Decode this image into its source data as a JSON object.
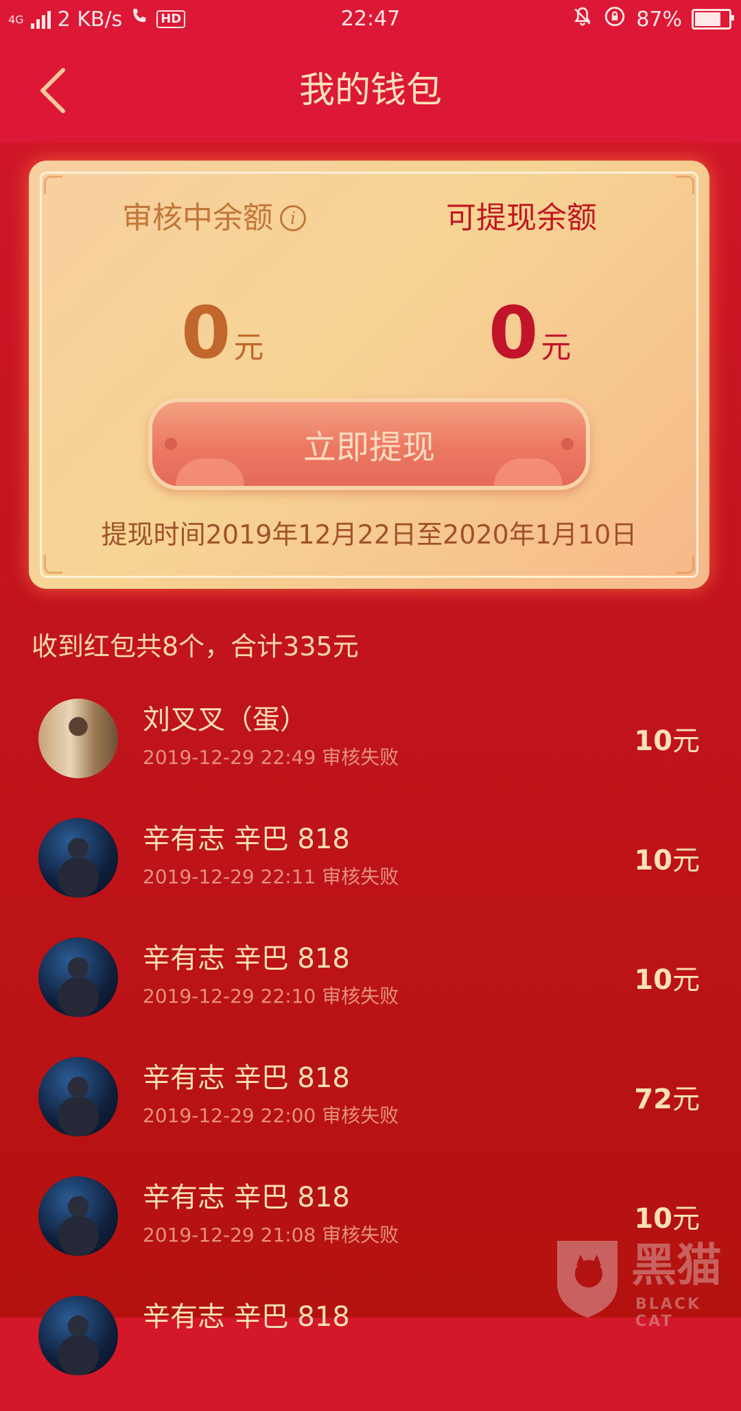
{
  "status_bar": {
    "network": "4G",
    "speed": "2 KB/s",
    "hd": "HD",
    "time": "22:47",
    "battery": "87%",
    "battery_level": 0.87
  },
  "header": {
    "title": "我的钱包"
  },
  "card": {
    "pending_label": "审核中余额",
    "withdrawable_label": "可提现余额",
    "pending_amount": "0",
    "withdrawable_amount": "0",
    "unit": "元",
    "button_label": "立即提现",
    "withdraw_time": "提现时间2019年12月22日至2020年1月10日"
  },
  "summary": "收到红包共8个，合计335元",
  "items": [
    {
      "name": "刘叉叉（蛋）",
      "meta": "2019-12-29 22:49 审核失败",
      "amount": "10",
      "unit": "元",
      "avatar": "room"
    },
    {
      "name": "辛有志 辛巴 818",
      "meta": "2019-12-29 22:11 审核失败",
      "amount": "10",
      "unit": "元",
      "avatar": "stage"
    },
    {
      "name": "辛有志 辛巴 818",
      "meta": "2019-12-29 22:10 审核失败",
      "amount": "10",
      "unit": "元",
      "avatar": "stage"
    },
    {
      "name": "辛有志 辛巴 818",
      "meta": "2019-12-29 22:00 审核失败",
      "amount": "72",
      "unit": "元",
      "avatar": "stage"
    },
    {
      "name": "辛有志 辛巴 818",
      "meta": "2019-12-29 21:08 审核失败",
      "amount": "10",
      "unit": "元",
      "avatar": "stage"
    },
    {
      "name": "辛有志 辛巴 818",
      "meta": "",
      "amount": "",
      "unit": "",
      "avatar": "stage"
    }
  ],
  "watermark": {
    "text": "黑猫",
    "sub": "BLACK CAT"
  },
  "colors": {
    "header": "#dc1836",
    "background": "#c41420",
    "card": "#f6d494",
    "accent_red": "#c11622",
    "accent_gold": "#fbe0b6"
  }
}
